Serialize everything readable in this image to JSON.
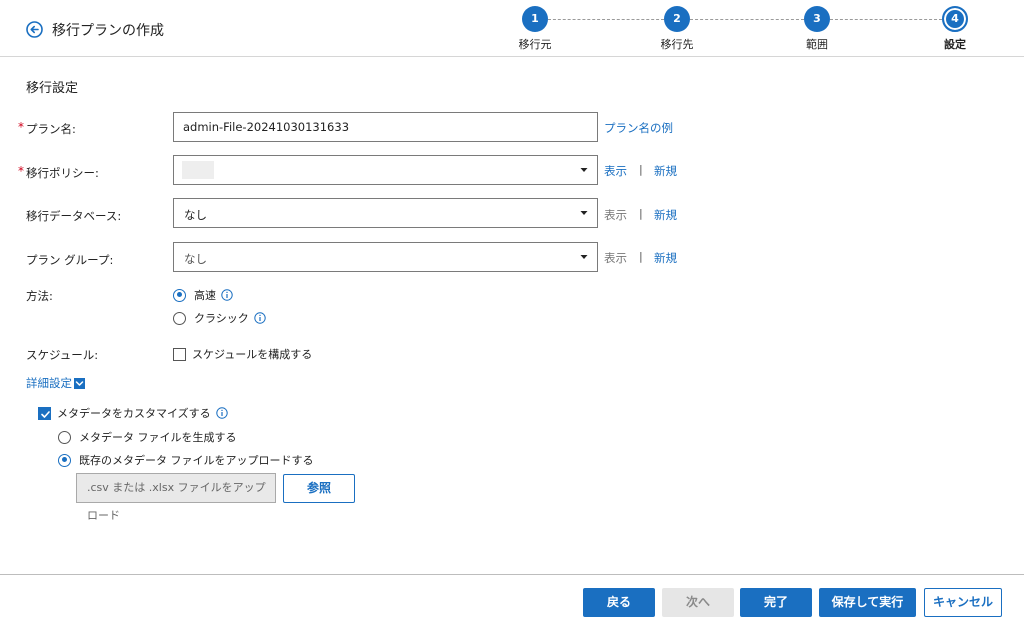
{
  "header": {
    "title": "移行プランの作成"
  },
  "stepper": {
    "steps": [
      {
        "number": "1",
        "label": "移行元"
      },
      {
        "number": "2",
        "label": "移行先"
      },
      {
        "number": "3",
        "label": "範囲"
      },
      {
        "number": "4",
        "label": "設定"
      }
    ],
    "current_step": "4"
  },
  "section": {
    "title": "移行設定"
  },
  "form": {
    "plan_name": {
      "label": "プラン名:",
      "value": "admin-File-20241030131633",
      "link": "プラン名の例"
    },
    "policy": {
      "label": "移行ポリシー:",
      "value": "",
      "view_link": "表示",
      "new_link": "新規"
    },
    "database": {
      "label": "移行データベース:",
      "value": "なし",
      "view_link": "表示",
      "new_link": "新規"
    },
    "plan_group": {
      "label": "プラン グループ:",
      "value": "なし",
      "view_link": "表示",
      "new_link": "新規"
    },
    "method": {
      "label": "方法:",
      "options": [
        {
          "label": "高速",
          "checked": true
        },
        {
          "label": "クラシック",
          "checked": false
        }
      ]
    },
    "schedule": {
      "label": "スケジュール:",
      "checkbox_label": "スケジュールを構成する",
      "checked": false
    },
    "separator": "|"
  },
  "advanced": {
    "toggle_label": "詳細設定",
    "customize_metadata": {
      "label": "メタデータをカスタマイズする",
      "checked": true
    },
    "metadata_options": [
      {
        "label": "メタデータ ファイルを生成する",
        "checked": false
      },
      {
        "label": "既存のメタデータ ファイルをアップロードする",
        "checked": true
      }
    ],
    "upload_placeholder": ".csv または .xlsx ファイルをアップロード",
    "browse_label": "参照"
  },
  "footer": {
    "back": "戻る",
    "next": "次へ",
    "finish": "完了",
    "save_run": "保存して実行",
    "cancel": "キャンセル"
  },
  "colors": {
    "accent": "#1a6fc1",
    "required": "#d0021b",
    "disabled_bg": "#e6e6e6"
  }
}
